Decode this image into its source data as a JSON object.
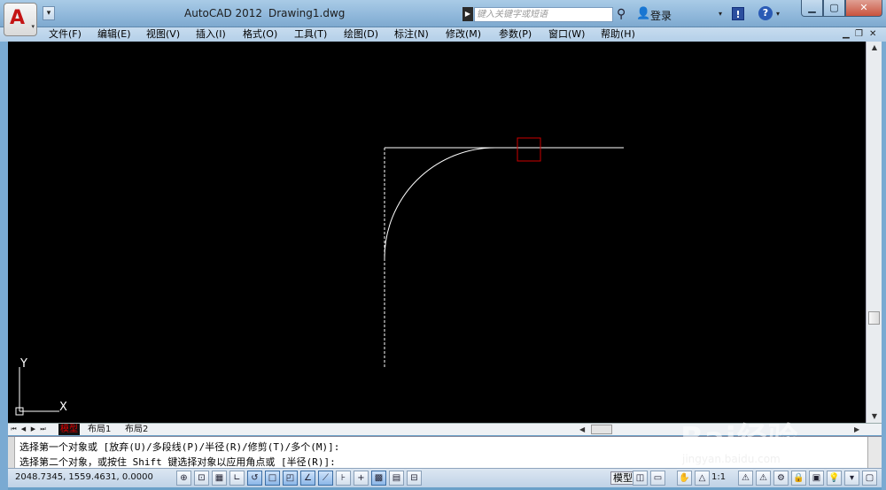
{
  "title_bar": {
    "app_title": "AutoCAD 2012",
    "document_title": "Drawing1.dwg",
    "search_placeholder": "键入关键字或短语",
    "login_label": "登录",
    "app_logo_letter": "A",
    "info_icon_glyph": "!",
    "help_icon_glyph": "?"
  },
  "menu": {
    "items": [
      "文件(F)",
      "编辑(E)",
      "视图(V)",
      "插入(I)",
      "格式(O)",
      "工具(T)",
      "绘图(D)",
      "标注(N)",
      "修改(M)",
      "参数(P)",
      "窗口(W)",
      "帮助(H)"
    ]
  },
  "drawing": {
    "background_color": "#000000",
    "line_color": "#ffffff",
    "pickbox_color": "#cc0000",
    "ucs_y_label": "Y",
    "ucs_x_label": "X"
  },
  "layout_tabs": {
    "items": [
      "模型",
      "布局1",
      "布局2"
    ],
    "active": "模型"
  },
  "command_line": {
    "lines": [
      "选择第一个对象或 [放弃(U)/多段线(P)/半径(R)/修剪(T)/多个(M)]:",
      "选择第二个对象，或按住 Shift 键选择对象以应用角点或 [半径(R)]:"
    ]
  },
  "status_bar": {
    "coordinates": "2048.7345, 1559.4631, 0.0000",
    "model_label": "模型",
    "annotation_scale": "1:1"
  },
  "watermark": {
    "text": "Bai经验",
    "url": "jingyan.baidu.com"
  }
}
